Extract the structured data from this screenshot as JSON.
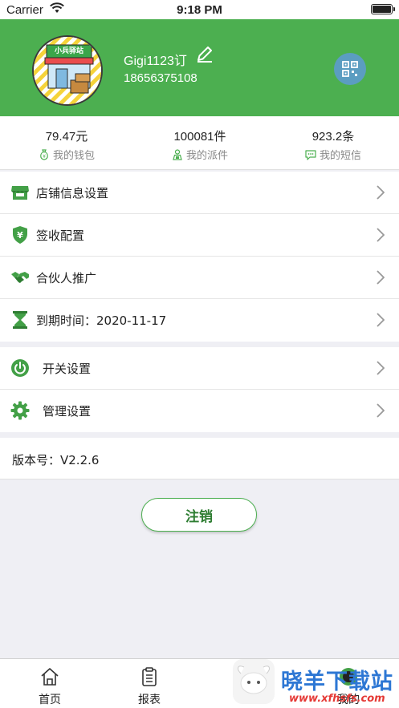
{
  "status_bar": {
    "carrier": "Carrier",
    "time": "9:18 PM"
  },
  "header": {
    "avatar_sign": "小兵驿站",
    "username": "Gigi1123订",
    "phone": "18656375108"
  },
  "stats": [
    {
      "value": "79.47元",
      "label": "我的钱包",
      "icon": "money-bag-icon"
    },
    {
      "value": "100081件",
      "label": "我的派件",
      "icon": "courier-icon"
    },
    {
      "value": "923.2条",
      "label": "我的短信",
      "icon": "message-icon"
    }
  ],
  "menu_group_1": [
    {
      "label": "店铺信息设置",
      "icon": "store-icon"
    },
    {
      "label": "签收配置",
      "icon": "shield-yuan-icon"
    },
    {
      "label": "合伙人推广",
      "icon": "handshake-icon"
    },
    {
      "label": "到期时间：2020-11-17",
      "icon": "hourglass-icon"
    }
  ],
  "menu_group_2": [
    {
      "label": "开关设置",
      "icon": "power-icon"
    },
    {
      "label": "管理设置",
      "icon": "gear-icon"
    }
  ],
  "version": "版本号：V2.2.6",
  "logout_label": "注销",
  "tabs": [
    {
      "label": "首页",
      "icon": "home-icon"
    },
    {
      "label": "报表",
      "icon": "clipboard-icon"
    },
    {
      "label": "",
      "icon": ""
    },
    {
      "label": "我的",
      "icon": "profile-icon"
    }
  ],
  "watermark": {
    "text": "晓羊下载站",
    "url": "www.xfhsfs.com"
  },
  "colors": {
    "header_green": "#4caf50",
    "icon_green": "#43a047",
    "qr_blue": "#5b9dc1"
  }
}
